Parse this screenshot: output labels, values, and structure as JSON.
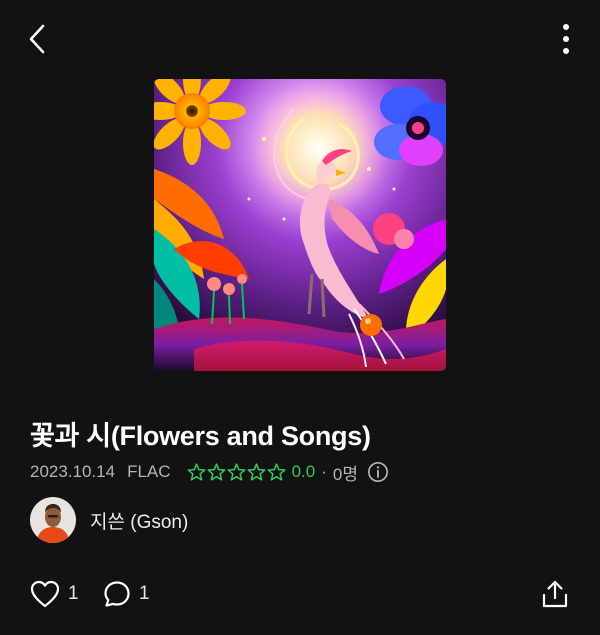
{
  "header": {
    "back_icon": "chevron-left-icon",
    "more_icon": "vertical-ellipsis-icon"
  },
  "track": {
    "title": "꽃과 시(Flowers and Songs)",
    "date": "2023.10.14",
    "format": "FLAC",
    "rating": {
      "stars_filled": 0,
      "stars_total": 5,
      "value": "0.0",
      "separator": "·",
      "voters": "0명"
    },
    "info_icon": "info-circle-icon"
  },
  "artist": {
    "name": "지쓴 (Gson)"
  },
  "actions": {
    "likes": "1",
    "comments": "1",
    "share_icon": "share-icon"
  },
  "colors": {
    "background": "#121212",
    "accent_green": "#33c45a",
    "muted_text": "#b5b5b5"
  }
}
